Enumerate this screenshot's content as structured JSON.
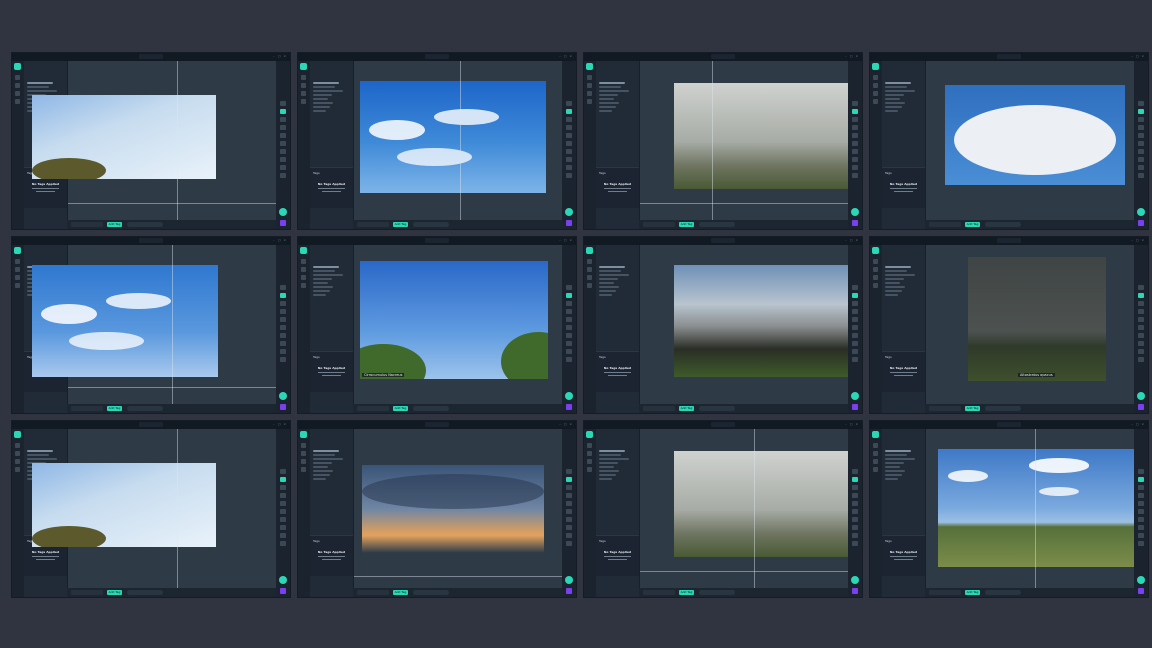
{
  "colors": {
    "accent": "#2bd8b6",
    "purple": "#7b3ff2",
    "bg": "#2f3440",
    "panel": "#1f2a36"
  },
  "panels": [
    {
      "title": "",
      "file": "",
      "counter": "",
      "photo": "wispy"
    },
    {
      "title": "",
      "file": "",
      "counter": "",
      "photo": "cumulus-blue"
    },
    {
      "title": "",
      "file": "",
      "counter": "",
      "photo": "fog"
    },
    {
      "title": "",
      "file": "",
      "counter": "",
      "photo": "cumulonimbus"
    },
    {
      "title": "",
      "file": "",
      "counter": "",
      "photo": "blue-sky"
    },
    {
      "title": "",
      "file": "",
      "counter": "",
      "photo": "cirrus-trees",
      "caption": "Cirrocumulus Nacreus"
    },
    {
      "title": "",
      "file": "",
      "counter": "",
      "photo": "shelf-fog"
    },
    {
      "title": "",
      "file": "",
      "counter": "",
      "photo": "dusk-field",
      "caption": "Altostratus opacus"
    },
    {
      "title": "",
      "file": "",
      "counter": "",
      "photo": "wispy"
    },
    {
      "title": "",
      "file": "",
      "counter": "",
      "photo": "sunset"
    },
    {
      "title": "",
      "file": "",
      "counter": "",
      "photo": "fog"
    },
    {
      "title": "",
      "file": "",
      "counter": "",
      "photo": "hay-field"
    }
  ],
  "ui": {
    "app_title": "",
    "sidebar_sub": "",
    "tab_a": "",
    "tab_b": "",
    "tags_label": "Tags",
    "no_tags": "No Tags Applied",
    "add_button": "Add Tag",
    "zoom_value": "",
    "pill_text": ""
  },
  "icons": {
    "logo": "app-logo-icon",
    "add": "plus-icon",
    "color": "purple-square-icon"
  }
}
